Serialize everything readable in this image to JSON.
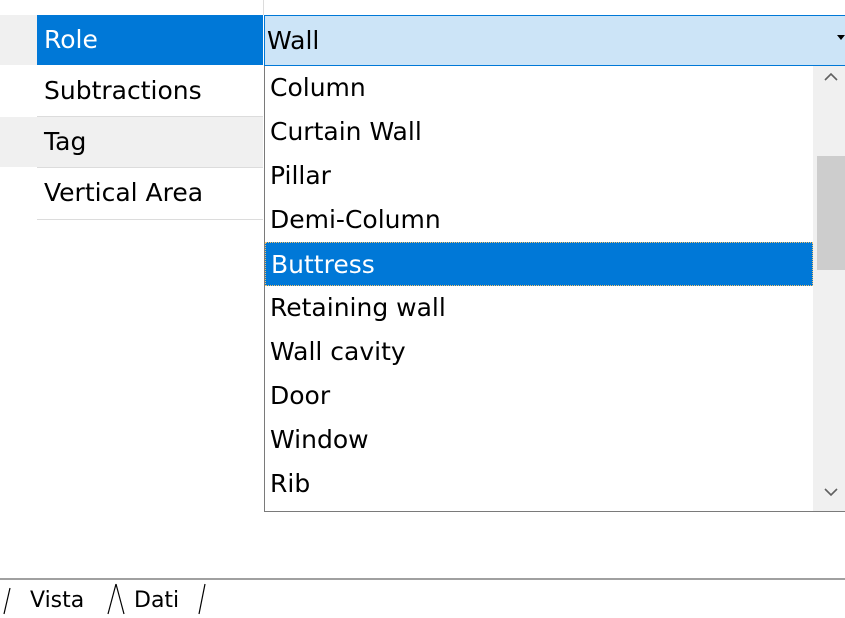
{
  "properties": [
    {
      "label": "Role"
    },
    {
      "label": "Subtractions"
    },
    {
      "label": "Tag"
    },
    {
      "label": "Vertical Area"
    }
  ],
  "combo": {
    "value": "Wall",
    "arrow_icon": "chevron-down-icon"
  },
  "dropdown": {
    "items": [
      "Column",
      "Curtain Wall",
      "Pillar",
      "Demi-Column",
      "Buttress",
      "Retaining wall",
      "Wall cavity",
      "Door",
      "Window",
      "Rib"
    ],
    "selected": "Buttress",
    "scroll_up_icon": "chevron-up-icon",
    "scroll_down_icon": "chevron-down-icon"
  },
  "tabs": {
    "items": [
      "Vista",
      "Dati"
    ],
    "active": "Dati"
  },
  "colors": {
    "selection": "#0078d7",
    "combo_background": "#cce4f7",
    "row_shade": "#f0f0f0"
  }
}
